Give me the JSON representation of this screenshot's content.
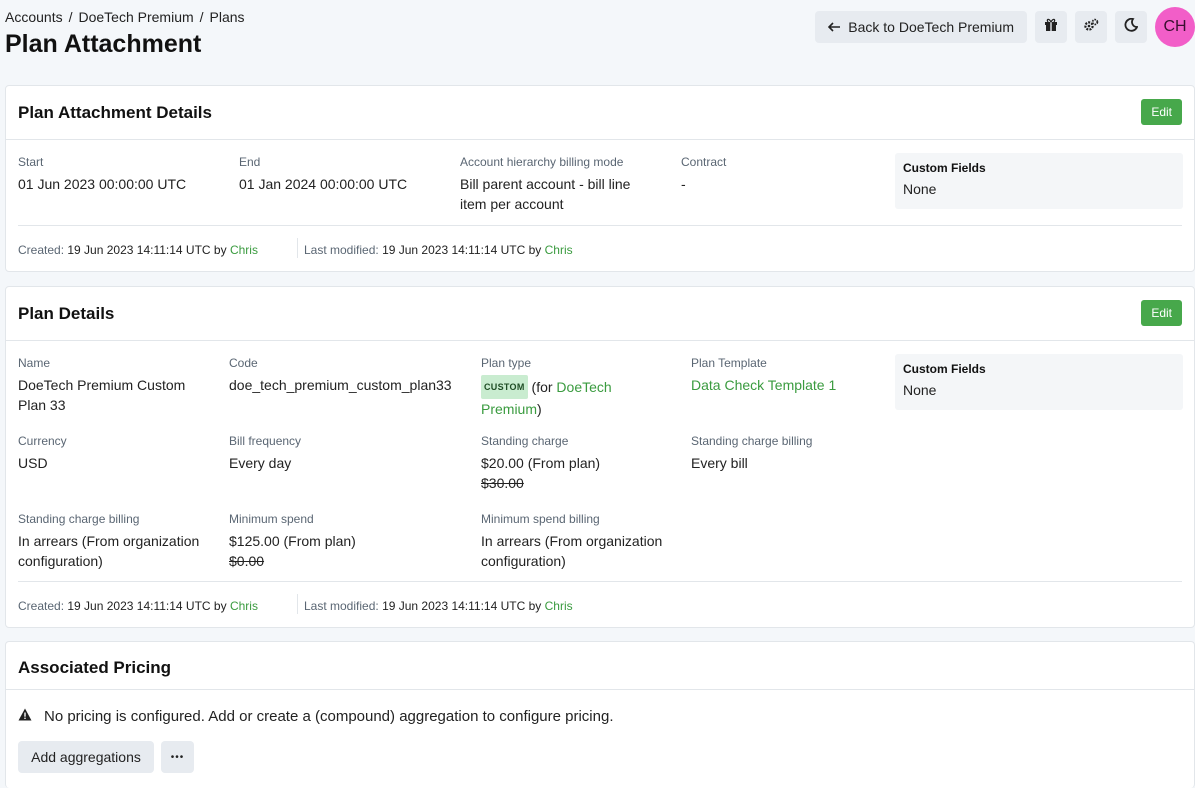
{
  "breadcrumb": [
    "Accounts",
    "DoeTech Premium",
    "Plans"
  ],
  "page_title": "Plan Attachment",
  "header_actions": {
    "back_label": "Back to DoeTech Premium",
    "avatar_initials": "CH"
  },
  "attachment_card": {
    "title": "Plan Attachment Details",
    "edit_label": "Edit",
    "start_label": "Start",
    "start_value": "01 Jun 2023 00:00:00 UTC",
    "end_label": "End",
    "end_value": "01 Jan 2024 00:00:00 UTC",
    "hierarchy_label": "Account hierarchy billing mode",
    "hierarchy_value": "Bill parent account - bill line item per account",
    "contract_label": "Contract",
    "contract_value": "-",
    "custom_fields_title": "Custom Fields",
    "custom_fields_value": "None",
    "created_label": "Created:",
    "created_value": "19 Jun 2023 14:11:14 UTC by",
    "created_by": "Chris",
    "modified_label": "Last modified:",
    "modified_value": "19 Jun 2023 14:11:14 UTC by",
    "modified_by": "Chris"
  },
  "plan_card": {
    "title": "Plan Details",
    "edit_label": "Edit",
    "name_label": "Name",
    "name_value": "DoeTech Premium Custom Plan 33",
    "code_label": "Code",
    "code_value": "doe_tech_premium_custom_plan33",
    "plan_type_label": "Plan type",
    "plan_type_badge": "CUSTOM",
    "plan_type_prefix": "(for",
    "plan_type_link": "DoeTech Premium",
    "plan_type_suffix": ")",
    "template_label": "Plan Template",
    "template_value": "Data Check Template 1",
    "custom_fields_title": "Custom Fields",
    "custom_fields_value": "None",
    "currency_label": "Currency",
    "currency_value": "USD",
    "bill_freq_label": "Bill frequency",
    "bill_freq_value": "Every day",
    "standing_charge_label": "Standing charge",
    "standing_charge_value": "$20.00 (From plan)",
    "standing_charge_old": "$30.00",
    "sc_billing_right_label": "Standing charge billing",
    "sc_billing_right_value": "Every bill",
    "sc_billing_label": "Standing charge billing",
    "sc_billing_value": "In arrears (From organization configuration)",
    "min_spend_label": "Minimum spend",
    "min_spend_value": "$125.00 (From plan)",
    "min_spend_old": "$0.00",
    "min_spend_billing_label": "Minimum spend billing",
    "min_spend_billing_value": "In arrears (From organization configuration)",
    "created_label": "Created:",
    "created_value": "19 Jun 2023 14:11:14 UTC by",
    "created_by": "Chris",
    "modified_label": "Last modified:",
    "modified_value": "19 Jun 2023 14:11:14 UTC by",
    "modified_by": "Chris"
  },
  "pricing_card": {
    "title": "Associated Pricing",
    "warning": "No pricing is configured. Add or create a (compound) aggregation to configure pricing.",
    "add_label": "Add aggregations",
    "more_label": "•••"
  },
  "icons": {
    "back": "arrow-left-icon",
    "gift": "gift-icon",
    "settings": "gears-icon",
    "theme": "moon-icon",
    "warning": "warning-triangle-icon"
  },
  "colors": {
    "accent": "#47a84b",
    "link": "#3a9b3f",
    "avatar": "#f25ec8"
  }
}
